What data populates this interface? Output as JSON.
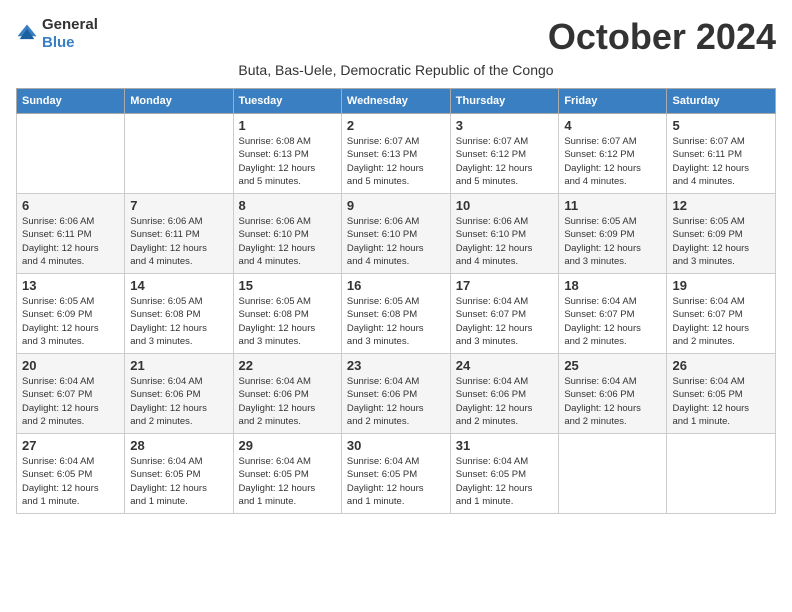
{
  "logo": {
    "general": "General",
    "blue": "Blue"
  },
  "title": "October 2024",
  "location": "Buta, Bas-Uele, Democratic Republic of the Congo",
  "days_of_week": [
    "Sunday",
    "Monday",
    "Tuesday",
    "Wednesday",
    "Thursday",
    "Friday",
    "Saturday"
  ],
  "weeks": [
    [
      {
        "day": "",
        "info": ""
      },
      {
        "day": "",
        "info": ""
      },
      {
        "day": "1",
        "info": "Sunrise: 6:08 AM\nSunset: 6:13 PM\nDaylight: 12 hours\nand 5 minutes."
      },
      {
        "day": "2",
        "info": "Sunrise: 6:07 AM\nSunset: 6:13 PM\nDaylight: 12 hours\nand 5 minutes."
      },
      {
        "day": "3",
        "info": "Sunrise: 6:07 AM\nSunset: 6:12 PM\nDaylight: 12 hours\nand 5 minutes."
      },
      {
        "day": "4",
        "info": "Sunrise: 6:07 AM\nSunset: 6:12 PM\nDaylight: 12 hours\nand 4 minutes."
      },
      {
        "day": "5",
        "info": "Sunrise: 6:07 AM\nSunset: 6:11 PM\nDaylight: 12 hours\nand 4 minutes."
      }
    ],
    [
      {
        "day": "6",
        "info": "Sunrise: 6:06 AM\nSunset: 6:11 PM\nDaylight: 12 hours\nand 4 minutes."
      },
      {
        "day": "7",
        "info": "Sunrise: 6:06 AM\nSunset: 6:11 PM\nDaylight: 12 hours\nand 4 minutes."
      },
      {
        "day": "8",
        "info": "Sunrise: 6:06 AM\nSunset: 6:10 PM\nDaylight: 12 hours\nand 4 minutes."
      },
      {
        "day": "9",
        "info": "Sunrise: 6:06 AM\nSunset: 6:10 PM\nDaylight: 12 hours\nand 4 minutes."
      },
      {
        "day": "10",
        "info": "Sunrise: 6:06 AM\nSunset: 6:10 PM\nDaylight: 12 hours\nand 4 minutes."
      },
      {
        "day": "11",
        "info": "Sunrise: 6:05 AM\nSunset: 6:09 PM\nDaylight: 12 hours\nand 3 minutes."
      },
      {
        "day": "12",
        "info": "Sunrise: 6:05 AM\nSunset: 6:09 PM\nDaylight: 12 hours\nand 3 minutes."
      }
    ],
    [
      {
        "day": "13",
        "info": "Sunrise: 6:05 AM\nSunset: 6:09 PM\nDaylight: 12 hours\nand 3 minutes."
      },
      {
        "day": "14",
        "info": "Sunrise: 6:05 AM\nSunset: 6:08 PM\nDaylight: 12 hours\nand 3 minutes."
      },
      {
        "day": "15",
        "info": "Sunrise: 6:05 AM\nSunset: 6:08 PM\nDaylight: 12 hours\nand 3 minutes."
      },
      {
        "day": "16",
        "info": "Sunrise: 6:05 AM\nSunset: 6:08 PM\nDaylight: 12 hours\nand 3 minutes."
      },
      {
        "day": "17",
        "info": "Sunrise: 6:04 AM\nSunset: 6:07 PM\nDaylight: 12 hours\nand 3 minutes."
      },
      {
        "day": "18",
        "info": "Sunrise: 6:04 AM\nSunset: 6:07 PM\nDaylight: 12 hours\nand 2 minutes."
      },
      {
        "day": "19",
        "info": "Sunrise: 6:04 AM\nSunset: 6:07 PM\nDaylight: 12 hours\nand 2 minutes."
      }
    ],
    [
      {
        "day": "20",
        "info": "Sunrise: 6:04 AM\nSunset: 6:07 PM\nDaylight: 12 hours\nand 2 minutes."
      },
      {
        "day": "21",
        "info": "Sunrise: 6:04 AM\nSunset: 6:06 PM\nDaylight: 12 hours\nand 2 minutes."
      },
      {
        "day": "22",
        "info": "Sunrise: 6:04 AM\nSunset: 6:06 PM\nDaylight: 12 hours\nand 2 minutes."
      },
      {
        "day": "23",
        "info": "Sunrise: 6:04 AM\nSunset: 6:06 PM\nDaylight: 12 hours\nand 2 minutes."
      },
      {
        "day": "24",
        "info": "Sunrise: 6:04 AM\nSunset: 6:06 PM\nDaylight: 12 hours\nand 2 minutes."
      },
      {
        "day": "25",
        "info": "Sunrise: 6:04 AM\nSunset: 6:06 PM\nDaylight: 12 hours\nand 2 minutes."
      },
      {
        "day": "26",
        "info": "Sunrise: 6:04 AM\nSunset: 6:05 PM\nDaylight: 12 hours\nand 1 minute."
      }
    ],
    [
      {
        "day": "27",
        "info": "Sunrise: 6:04 AM\nSunset: 6:05 PM\nDaylight: 12 hours\nand 1 minute."
      },
      {
        "day": "28",
        "info": "Sunrise: 6:04 AM\nSunset: 6:05 PM\nDaylight: 12 hours\nand 1 minute."
      },
      {
        "day": "29",
        "info": "Sunrise: 6:04 AM\nSunset: 6:05 PM\nDaylight: 12 hours\nand 1 minute."
      },
      {
        "day": "30",
        "info": "Sunrise: 6:04 AM\nSunset: 6:05 PM\nDaylight: 12 hours\nand 1 minute."
      },
      {
        "day": "31",
        "info": "Sunrise: 6:04 AM\nSunset: 6:05 PM\nDaylight: 12 hours\nand 1 minute."
      },
      {
        "day": "",
        "info": ""
      },
      {
        "day": "",
        "info": ""
      }
    ]
  ]
}
